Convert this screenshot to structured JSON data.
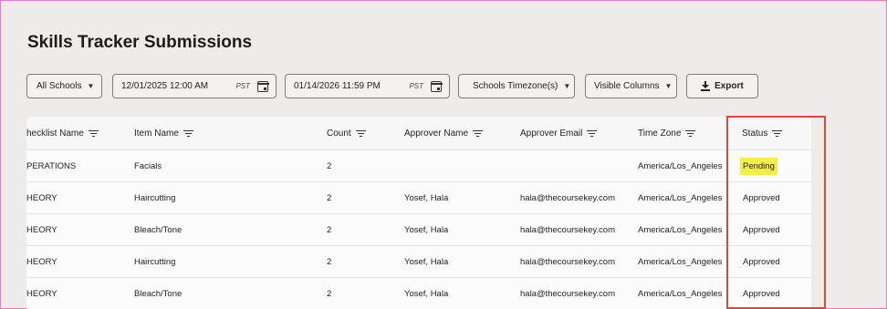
{
  "page": {
    "title": "Skills Tracker Submissions"
  },
  "filters": {
    "schools": {
      "label": "All Schools"
    },
    "start_date": {
      "value": "12/01/2025 12:00 AM",
      "tz": "PST"
    },
    "end_date": {
      "value": "01/14/2026 11:59 PM",
      "tz": "PST"
    },
    "timezone": {
      "label": "Schools Timezone(s)"
    },
    "columns": {
      "label": "Visible Columns"
    },
    "export": {
      "label": "Export"
    }
  },
  "table": {
    "columns": [
      "hecklist Name",
      "Item Name",
      "Count",
      "Approver Name",
      "Approver Email",
      "Time Zone",
      "Status"
    ],
    "rows": [
      {
        "checklist": "PERATIONS",
        "item": "Facials",
        "count": "2",
        "approver": "",
        "email": "",
        "tz": "America/Los_Angeles",
        "status": "Pending"
      },
      {
        "checklist": "HEORY",
        "item": "Haircutting",
        "count": "2",
        "approver": "Yosef, Hala",
        "email": "hala@thecoursekey.com",
        "tz": "America/Los_Angeles",
        "status": "Approved"
      },
      {
        "checklist": "HEORY",
        "item": "Bleach/Tone",
        "count": "2",
        "approver": "Yosef, Hala",
        "email": "hala@thecoursekey.com",
        "tz": "America/Los_Angeles",
        "status": "Approved"
      },
      {
        "checklist": "HEORY",
        "item": "Haircutting",
        "count": "2",
        "approver": "Yosef, Hala",
        "email": "hala@thecoursekey.com",
        "tz": "America/Los_Angeles",
        "status": "Approved"
      },
      {
        "checklist": "HEORY",
        "item": "Bleach/Tone",
        "count": "2",
        "approver": "Yosef, Hala",
        "email": "hala@thecoursekey.com",
        "tz": "America/Los_Angeles",
        "status": "Approved"
      }
    ]
  },
  "colors": {
    "pending_highlight": "#f3ef45",
    "annotation_box": "#d9483d"
  }
}
